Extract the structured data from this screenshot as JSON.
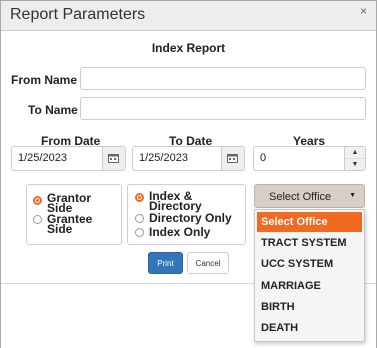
{
  "dialog": {
    "title": "Report Parameters",
    "close_glyph": "×"
  },
  "report": {
    "heading": "Index Report"
  },
  "fields": {
    "from_name_label": "From Name",
    "from_name_value": "",
    "to_name_label": "To Name",
    "to_name_value": "",
    "from_date_label": "From Date",
    "from_date_value": "1/25/2023",
    "to_date_label": "To Date",
    "to_date_value": "1/25/2023",
    "years_label": "Years",
    "years_value": "0"
  },
  "side_options": {
    "selected": "Grantor Side",
    "items": [
      {
        "line1": "Grantor",
        "line2": "Side"
      },
      {
        "line1": "Grantee",
        "line2": "Side"
      }
    ]
  },
  "index_options": {
    "selected": "Index & Directory",
    "items": [
      {
        "line1": "Index &",
        "line2": "Directory"
      },
      {
        "line1": "Directory Only",
        "line2": ""
      },
      {
        "line1": "Index Only",
        "line2": ""
      }
    ]
  },
  "office_select": {
    "value": "Select Office",
    "options": [
      "Select Office",
      "TRACT SYSTEM",
      "UCC SYSTEM",
      "MARRIAGE",
      "BIRTH",
      "DEATH"
    ],
    "highlighted": "Select Office"
  },
  "buttons": {
    "print": "Print",
    "cancel": "Cancel"
  },
  "icons": {
    "close": "close-icon",
    "calendar": "calendar-icon",
    "spin_up": "chevron-up-icon",
    "spin_down": "chevron-down-icon",
    "select_caret": "caret-down-icon"
  },
  "colors": {
    "accent": "#f26a21",
    "primary_button": "#3276b8",
    "titlebar": "#ededed"
  }
}
